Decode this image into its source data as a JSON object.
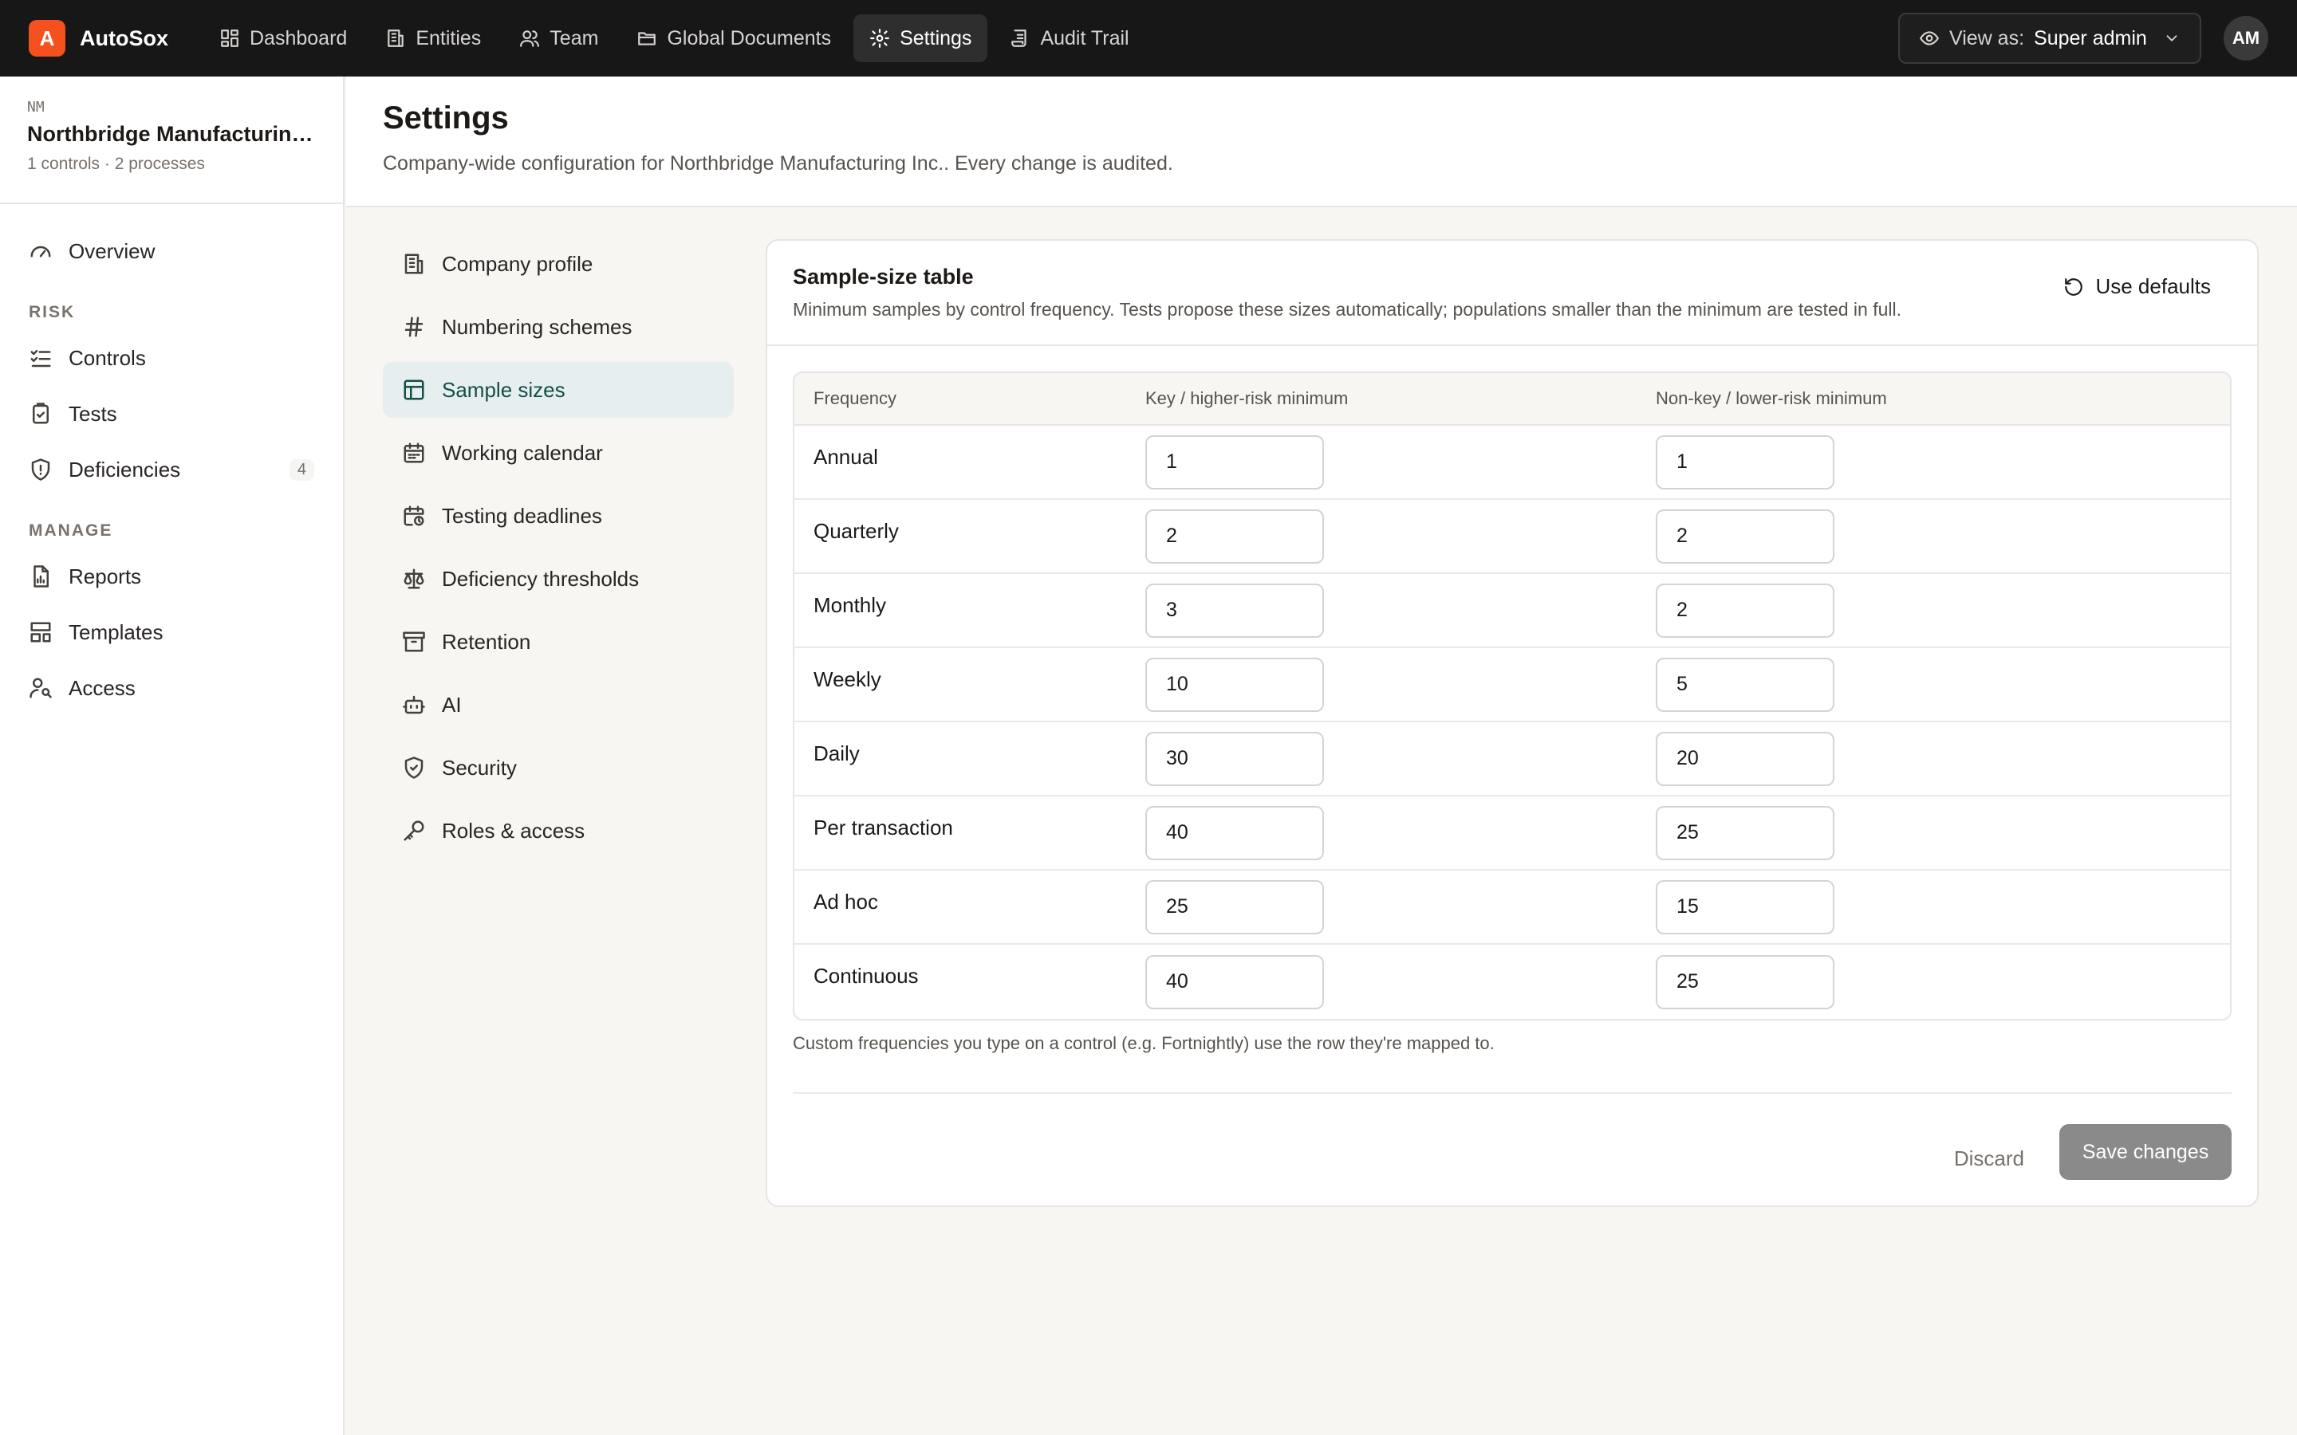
{
  "app": {
    "logo_letter": "A",
    "name": "AutoSox"
  },
  "topnav": {
    "items": [
      {
        "label": "Dashboard",
        "icon": "dashboard-icon"
      },
      {
        "label": "Entities",
        "icon": "building-icon"
      },
      {
        "label": "Team",
        "icon": "users-icon"
      },
      {
        "label": "Global Documents",
        "icon": "folder-icon"
      },
      {
        "label": "Settings",
        "icon": "gear-icon",
        "active": true
      },
      {
        "label": "Audit Trail",
        "icon": "scroll-icon"
      }
    ],
    "view_as_label": "View as:",
    "view_as_value": "Super admin",
    "avatar_initials": "AM"
  },
  "org": {
    "code": "NM",
    "name": "Northbridge Manufacturing Inc.",
    "meta": "1 controls · 2 processes"
  },
  "sidebar": {
    "overview": "Overview",
    "risk_label": "RISK",
    "risk_items": [
      {
        "label": "Controls"
      },
      {
        "label": "Tests"
      },
      {
        "label": "Deficiencies",
        "count": "4"
      }
    ],
    "manage_label": "MANAGE",
    "manage_items": [
      {
        "label": "Reports"
      },
      {
        "label": "Templates"
      },
      {
        "label": "Access"
      }
    ]
  },
  "page": {
    "title": "Settings",
    "subtitle": "Company-wide configuration for Northbridge Manufacturing Inc.. Every change is audited."
  },
  "settings_nav": [
    {
      "label": "Company profile"
    },
    {
      "label": "Numbering schemes"
    },
    {
      "label": "Sample sizes",
      "active": true
    },
    {
      "label": "Working calendar"
    },
    {
      "label": "Testing deadlines"
    },
    {
      "label": "Deficiency thresholds"
    },
    {
      "label": "Retention"
    },
    {
      "label": "AI"
    },
    {
      "label": "Security"
    },
    {
      "label": "Roles & access"
    }
  ],
  "card": {
    "title": "Sample-size table",
    "description": "Minimum samples by control frequency. Tests propose these sizes automatically; populations smaller than the minimum are tested in full.",
    "use_defaults": "Use defaults",
    "columns": [
      "Frequency",
      "Key / higher-risk minimum",
      "Non-key / lower-risk minimum"
    ],
    "rows": [
      {
        "frequency": "Annual",
        "key": "1",
        "nonkey": "1"
      },
      {
        "frequency": "Quarterly",
        "key": "2",
        "nonkey": "2"
      },
      {
        "frequency": "Monthly",
        "key": "3",
        "nonkey": "2"
      },
      {
        "frequency": "Weekly",
        "key": "10",
        "nonkey": "5"
      },
      {
        "frequency": "Daily",
        "key": "30",
        "nonkey": "20"
      },
      {
        "frequency": "Per transaction",
        "key": "40",
        "nonkey": "25"
      },
      {
        "frequency": "Ad hoc",
        "key": "25",
        "nonkey": "15"
      },
      {
        "frequency": "Continuous",
        "key": "40",
        "nonkey": "25"
      }
    ],
    "note": "Custom frequencies you type on a control (e.g. Fortnightly) use the row they're mapped to.",
    "discard": "Discard",
    "save": "Save changes"
  },
  "colors": {
    "brand": "#f4511e",
    "topbar": "#171717",
    "active_bg": "#e7eeef",
    "save_disabled": "#8a8a8a"
  }
}
